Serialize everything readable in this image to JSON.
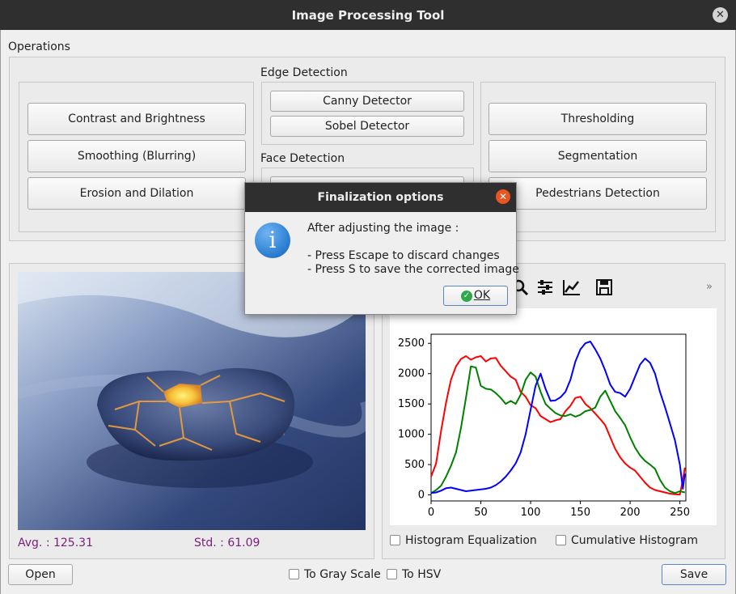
{
  "window": {
    "title": "Image Processing Tool",
    "close_glyph": "✕"
  },
  "operations": {
    "label": "Operations",
    "left_buttons": [
      "Contrast and Brightness",
      "Smoothing (Blurring)",
      "Erosion and Dilation"
    ],
    "edge_detection": {
      "label": "Edge Detection",
      "buttons": [
        "Canny Detector",
        "Sobel Detector"
      ]
    },
    "face_detection": {
      "label": "Face Detection"
    },
    "right_buttons": [
      "Thresholding",
      "Segmentation",
      "Pedestrians Detection"
    ]
  },
  "image_stats": {
    "avg": "Avg. : 125.31",
    "std": "Std. : 61.09"
  },
  "toolbar": {
    "icons": [
      "zoom-icon",
      "configure-subplots-icon",
      "edit-axes-icon",
      "save-figure-icon"
    ],
    "overflow": "»"
  },
  "histogram": {
    "equalization_label": "Histogram Equalization",
    "cumulative_label": "Cumulative Histogram"
  },
  "chart_data": {
    "type": "line",
    "xlim": [
      0,
      256
    ],
    "ylim": [
      -100,
      2650
    ],
    "xticks": [
      "0",
      "50",
      "100",
      "150",
      "200",
      "250"
    ],
    "yticks": [
      "0",
      "500",
      "1000",
      "1500",
      "2000",
      "2500"
    ],
    "grid": false,
    "series": [
      {
        "color": "#ff0000",
        "x": [
          0,
          5,
          10,
          15,
          20,
          25,
          30,
          35,
          40,
          45,
          50,
          55,
          60,
          65,
          70,
          75,
          80,
          85,
          90,
          95,
          100,
          105,
          110,
          115,
          120,
          125,
          130,
          135,
          140,
          145,
          150,
          155,
          160,
          165,
          170,
          175,
          180,
          185,
          190,
          195,
          200,
          205,
          210,
          215,
          220,
          225,
          230,
          235,
          240,
          245,
          250,
          253,
          255
        ],
        "y": [
          300,
          520,
          1050,
          1520,
          1900,
          2120,
          2240,
          2290,
          2230,
          2270,
          2290,
          2200,
          2250,
          2260,
          2130,
          2040,
          1950,
          1900,
          1700,
          1620,
          1480,
          1430,
          1300,
          1250,
          1200,
          1230,
          1250,
          1380,
          1470,
          1600,
          1620,
          1500,
          1430,
          1340,
          1250,
          1150,
          950,
          760,
          620,
          520,
          450,
          400,
          300,
          200,
          120,
          80,
          60,
          40,
          20,
          10,
          5,
          250,
          450
        ]
      },
      {
        "color": "#008000",
        "x": [
          0,
          5,
          10,
          15,
          20,
          25,
          30,
          35,
          40,
          45,
          50,
          55,
          60,
          65,
          70,
          75,
          80,
          85,
          90,
          95,
          100,
          105,
          110,
          115,
          120,
          125,
          130,
          135,
          140,
          145,
          150,
          155,
          160,
          165,
          170,
          175,
          180,
          185,
          190,
          195,
          200,
          205,
          210,
          215,
          220,
          225,
          230,
          235,
          240,
          245,
          250,
          255
        ],
        "y": [
          30,
          80,
          150,
          300,
          480,
          700,
          1100,
          1600,
          2120,
          2100,
          1800,
          1750,
          1740,
          1680,
          1600,
          1500,
          1550,
          1500,
          1650,
          1900,
          2020,
          1950,
          1700,
          1500,
          1420,
          1350,
          1310,
          1300,
          1330,
          1290,
          1320,
          1380,
          1400,
          1440,
          1620,
          1720,
          1550,
          1380,
          1270,
          1150,
          950,
          780,
          650,
          560,
          500,
          430,
          250,
          120,
          60,
          30,
          60,
          40
        ]
      },
      {
        "color": "#0000ff",
        "x": [
          0,
          5,
          10,
          15,
          20,
          25,
          30,
          35,
          40,
          45,
          50,
          55,
          60,
          65,
          70,
          75,
          80,
          85,
          90,
          95,
          100,
          105,
          110,
          115,
          120,
          125,
          130,
          135,
          140,
          145,
          150,
          155,
          160,
          165,
          170,
          175,
          180,
          185,
          190,
          195,
          200,
          205,
          210,
          215,
          220,
          225,
          230,
          235,
          240,
          245,
          250,
          253,
          255
        ],
        "y": [
          30,
          40,
          70,
          110,
          120,
          100,
          80,
          60,
          70,
          80,
          90,
          100,
          120,
          160,
          220,
          300,
          400,
          520,
          700,
          1000,
          1400,
          1800,
          2000,
          1750,
          1550,
          1560,
          1610,
          1700,
          1900,
          2200,
          2400,
          2500,
          2530,
          2400,
          2250,
          2050,
          1820,
          1700,
          1680,
          1620,
          1750,
          1950,
          2150,
          2250,
          2180,
          2000,
          1700,
          1450,
          1180,
          900,
          500,
          100,
          350
        ]
      }
    ]
  },
  "dialog": {
    "title": "Finalization options",
    "heading": "After adjusting the image :",
    "line1": "- Press Escape to discard changes",
    "line2": "- Press S to save the corrected image",
    "ok_label": "OK",
    "icon": "information-icon",
    "icon_glyph": "i",
    "close_glyph": "✕"
  },
  "bottom": {
    "open_label": "Open",
    "gray_label": "To Gray Scale",
    "hsv_label": "To HSV",
    "save_label": "Save"
  },
  "colors": {
    "accent": "#e95420",
    "titlebar": "#2f2f2f",
    "stats": "#7a1e7a",
    "ok_icon": "#2ea84a",
    "info_icon": "#2d7fd3"
  }
}
